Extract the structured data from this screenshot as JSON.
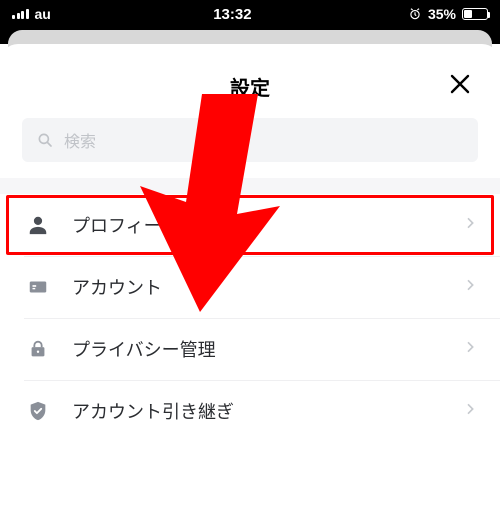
{
  "status": {
    "carrier": "au",
    "time": "13:32",
    "battery_pct": "35%",
    "battery_fill_pct": 35
  },
  "header": {
    "title": "設定"
  },
  "search": {
    "placeholder": "検索"
  },
  "list": {
    "items": [
      {
        "label": "プロフィール"
      },
      {
        "label": "アカウント"
      },
      {
        "label": "プライバシー管理"
      },
      {
        "label": "アカウント引き継ぎ"
      }
    ]
  },
  "annotation": {
    "arrow_color": "#ff0000",
    "highlight_color": "#ff0000",
    "highlighted_index": 0
  }
}
